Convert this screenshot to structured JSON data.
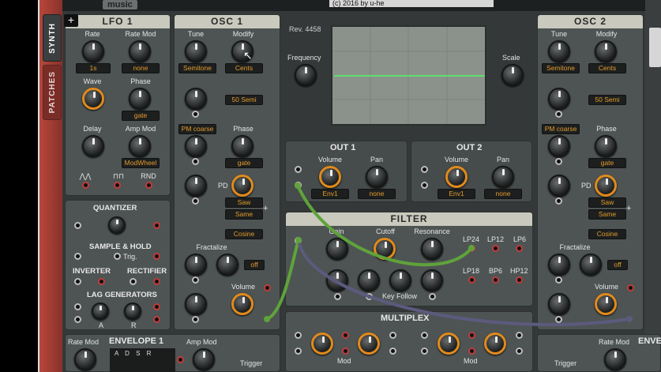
{
  "topbar": {
    "logo_text": "music",
    "copyright": "(c) 2016 by u-he"
  },
  "tabs": {
    "synth": "SYNTH",
    "patches": "PATCHES"
  },
  "lfo1": {
    "title": "LFO 1",
    "rate_label": "Rate",
    "rate_value": "1s",
    "rate_mod_label": "Rate Mod",
    "rate_mod_value": "none",
    "wave_label": "Wave",
    "phase_label": "Phase",
    "phase_value": "gate",
    "delay_label": "Delay",
    "amp_mod_label": "Amp Mod",
    "amp_mod_value": "ModWheel",
    "rnd_label": "RND"
  },
  "mods": {
    "quantizer": "QUANTIZER",
    "sample_hold": "SAMPLE & HOLD",
    "trig": "Trig.",
    "inverter": "INVERTER",
    "rectifier": "RECTIFIER",
    "lag": "LAG GENERATORS",
    "a": "A",
    "r": "R"
  },
  "osc1": {
    "title": "OSC 1",
    "tune_label": "Tune",
    "tune_value": "Semitone",
    "modify_label": "Modify",
    "modify_value": "Cents",
    "semi_value": "50 Semi",
    "pm_value": "PM coarse",
    "phase_label": "Phase",
    "phase_value": "gate",
    "pd_label": "PD",
    "wave_value": "Saw",
    "sync_value": "Same",
    "shape_value": "Cosine",
    "fractalize_label": "Fractalize",
    "fractalize_value": "off",
    "volume_label": "Volume"
  },
  "center": {
    "rev": "Rev. 4458",
    "frequency_label": "Frequency",
    "scale_label": "Scale"
  },
  "out1": {
    "title": "OUT 1",
    "volume_label": "Volume",
    "volume_value": "Env1",
    "pan_label": "Pan",
    "pan_value": "none"
  },
  "out2": {
    "title": "OUT 2",
    "volume_label": "Volume",
    "volume_value": "Env1",
    "pan_label": "Pan",
    "pan_value": "none"
  },
  "filter": {
    "title": "FILTER",
    "gain_label": "Gain",
    "cutoff_label": "Cutoff",
    "resonance_label": "Resonance",
    "key_follow_label": "Key Follow",
    "lp24": "LP24",
    "lp12": "LP12",
    "lp6": "LP6",
    "lp18": "LP18",
    "bp6": "BP6",
    "hp12": "HP12"
  },
  "multiplex": {
    "title": "MULTIPLEX",
    "mod_label_1": "Mod",
    "mod_label_2": "Mod"
  },
  "osc2": {
    "title": "OSC 2",
    "tune_label": "Tune",
    "tune_value": "Semitone",
    "modify_label": "Modify",
    "modify_value": "Cents",
    "semi_value": "50 Semi",
    "pm_value": "PM coarse",
    "phase_label": "Phase",
    "phase_value": "gate",
    "pd_label": "PD",
    "wave_value": "Saw",
    "sync_value": "Same",
    "shape_value": "Cosine",
    "fractalize_label": "Fractalize",
    "fractalize_value": "off",
    "volume_label": "Volume"
  },
  "envelope1": {
    "rate_mod_label": "Rate Mod",
    "title": "ENVELOPE 1",
    "adsr": "A D S R",
    "amp_mod_label": "Amp Mod",
    "trigger_label": "Trigger"
  },
  "bottom_right": {
    "rate_mod_label": "Rate Mod",
    "title_partial": "ENVE",
    "trigger_label": "Trigger"
  },
  "colors": {
    "accent_orange": "#e08a1c",
    "cable_green": "#5fa33a",
    "cable_purple": "#5d5a7e",
    "scope_trace": "#5ee06a"
  }
}
